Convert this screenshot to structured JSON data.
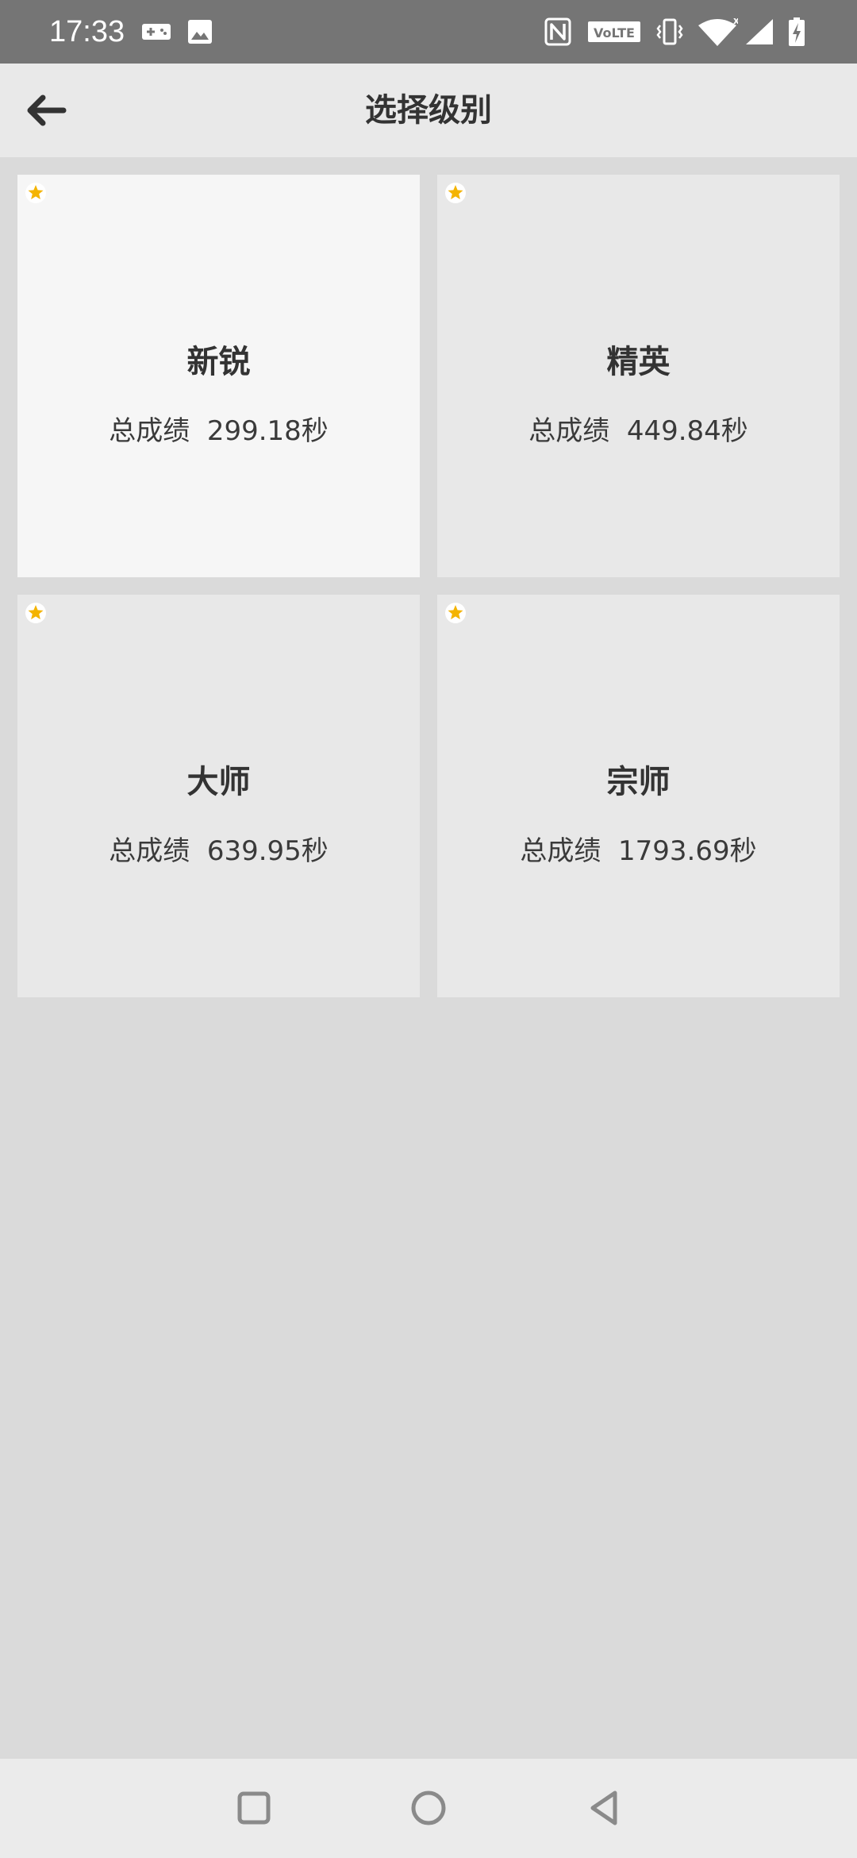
{
  "status_bar": {
    "time": "17:33",
    "icons": [
      "gamepad-icon",
      "image-icon",
      "nfc-icon",
      "volte-icon",
      "vibrate-icon",
      "wifi-icon",
      "cell-signal-icon",
      "battery-charging-icon"
    ],
    "volte_label": "VoLTE"
  },
  "app_bar": {
    "title": "选择级别",
    "back_icon": "arrow-left-icon"
  },
  "levels": [
    {
      "name": "新锐",
      "score": "总成绩  299.18秒",
      "selected": true
    },
    {
      "name": "精英",
      "score": "总成绩  449.84秒",
      "selected": false
    },
    {
      "name": "大师",
      "score": "总成绩  639.95秒",
      "selected": false
    },
    {
      "name": "宗师",
      "score": "总成绩  1793.69秒",
      "selected": false
    }
  ],
  "colors": {
    "star": "#f4b400",
    "background": "#dadada",
    "card": "#e8e8e8",
    "card_selected": "#f6f6f6",
    "status_bar": "#757575"
  },
  "nav_bar": {
    "buttons": [
      "recents-square-icon",
      "home-circle-icon",
      "back-triangle-icon"
    ]
  }
}
